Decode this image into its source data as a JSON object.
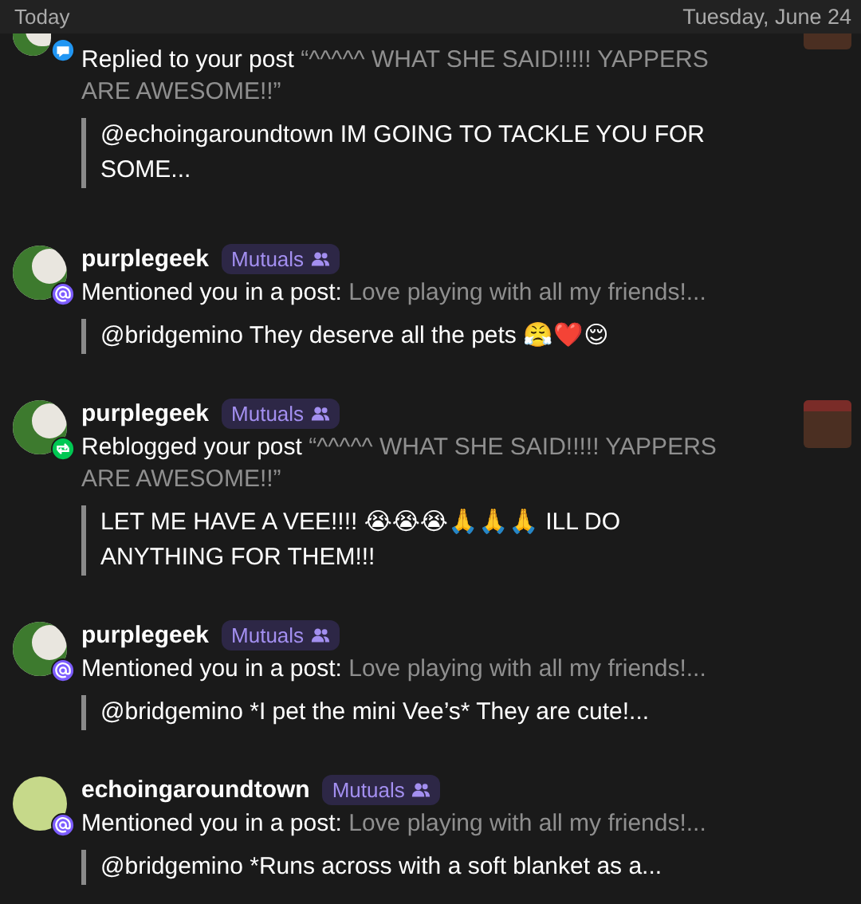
{
  "header": {
    "section": "Today",
    "date": "Tuesday, June 24"
  },
  "notifications": [
    {
      "kind": "reply",
      "action": "Replied to your post",
      "post": "“^^^^^ WHAT SHE SAID!!!!! YAPPERS ARE AWESOME!!”",
      "quote": "@echoingaroundtown IM GOING TO TACKLE YOU FOR SOME...",
      "thumbnail": true
    },
    {
      "kind": "mention",
      "username": "purplegeek",
      "badge": "Mutuals",
      "action": "Mentioned you in a post:",
      "post": "Love playing with all my friends!...",
      "quote": "@bridgemino They deserve all the pets 😤❤️😌",
      "thumbnail": false
    },
    {
      "kind": "reblog",
      "username": "purplegeek",
      "badge": "Mutuals",
      "action": "Reblogged your post",
      "post": "“^^^^^ WHAT SHE SAID!!!!! YAPPERS ARE AWESOME!!”",
      "quote": "LET ME HAVE A VEE!!!! 😭😭😭🙏🙏🙏 ILL DO ANYTHING FOR THEM!!!",
      "thumbnail": true
    },
    {
      "kind": "mention",
      "username": "purplegeek",
      "badge": "Mutuals",
      "action": "Mentioned you in a post:",
      "post": "Love playing with all my friends!...",
      "quote": "@bridgemino *I pet the mini Vee’s* They are cute!...",
      "thumbnail": false
    },
    {
      "kind": "mention",
      "username": "echoingaroundtown",
      "badge": "Mutuals",
      "action": "Mentioned you in a post:",
      "post": "Love playing with all my friends!...",
      "quote": "@bridgemino *Runs across with a soft blanket as a...",
      "thumbnail": false
    }
  ]
}
